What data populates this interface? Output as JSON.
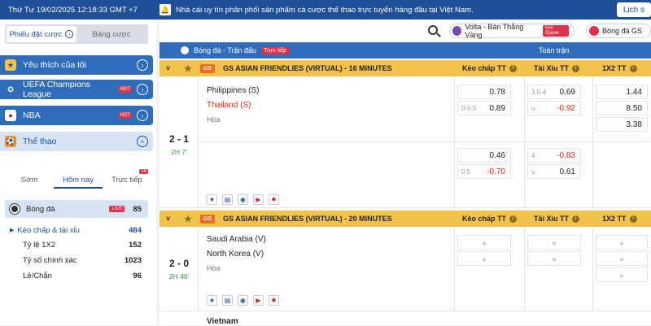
{
  "topbar": {
    "datetime": "Thứ Tư 19/02/2025 12:18:33 GMT +7",
    "notice": "Nhà cái uy tín phân phối sản phẩm cá cược thể thao trực tuyến hàng đầu tại Việt Nam.",
    "calendar_label": "Lịch s"
  },
  "sidebar": {
    "tabs": [
      "Phiếu đặt cược",
      "Bảng cược"
    ],
    "categories": [
      {
        "label": "Yêu thích của tôi",
        "icon": "star-icon"
      },
      {
        "label": "UEFA Champions League",
        "badge": "HOT",
        "icon": "trophy-icon"
      },
      {
        "label": "NBA",
        "badge": "HOT",
        "icon": "basketball-icon"
      },
      {
        "label": "Thể thao",
        "icon": "sports-icon"
      }
    ],
    "subtabs": [
      "Sớm",
      "Hôm nay",
      "Trực tiếp"
    ],
    "live_count_badge": "16",
    "sport": {
      "label": "Bóng đá",
      "badge": "LIVE",
      "count": "85"
    },
    "markets": [
      {
        "label": "Kèo chấp & tài xỉu",
        "count": "484"
      },
      {
        "label": "Tỷ lệ 1X2",
        "count": "152"
      },
      {
        "label": "Tỷ số chính xác",
        "count": "1023"
      },
      {
        "label": "Lẻ/Chẵn",
        "count": "96"
      }
    ]
  },
  "header": {
    "pills": [
      {
        "label": "Volta - Bàn Thắng Vàng",
        "badge": "Hot Game"
      },
      {
        "label": "Bóng đá GS"
      }
    ],
    "section_title": "Bóng đá - Trận đấu",
    "live_badge": "Trực tiếp",
    "full_match": "Toàn trận"
  },
  "columns": {
    "handicap": "Kèo chấp TT",
    "overunder": "Tài Xỉu TT",
    "x12": "1X2 TT"
  },
  "leagues": [
    {
      "logo": "GS",
      "name": "GS ASIAN FRIENDLIES (VIRTUAL) - 16 MINUTES",
      "match": {
        "score": "2 - 1",
        "time": "2H 7'",
        "home": "Philippines (S)",
        "away": "Thailand (S)",
        "draw": "Hòa",
        "row1": {
          "hdp": [
            {
              "line": "",
              "val": "0.78"
            },
            {
              "line": "0-0.5",
              "val": "0.89"
            }
          ],
          "ou": [
            {
              "line": "3.5-4",
              "val": "0.69"
            },
            {
              "line": "u",
              "val": "-0.92"
            }
          ],
          "x12": [
            "1.44",
            "8.50",
            "3.38"
          ]
        },
        "row2": {
          "hdp": [
            {
              "line": "",
              "val": "0.46"
            },
            {
              "line": "0.5",
              "val": "-0.70"
            }
          ],
          "ou": [
            {
              "line": "4",
              "val": "-0.83"
            },
            {
              "line": "u",
              "val": "0.61"
            }
          ]
        }
      }
    },
    {
      "logo": "GS",
      "name": "GS ASIAN FRIENDLIES (VIRTUAL) - 20 MINUTES",
      "match": {
        "score": "2 - 0",
        "time": "2H 46'",
        "home": "Saudi Arabia (V)",
        "away": "North Korea (V)",
        "draw": "Hòa"
      },
      "next_team": "Vietnam"
    }
  ]
}
